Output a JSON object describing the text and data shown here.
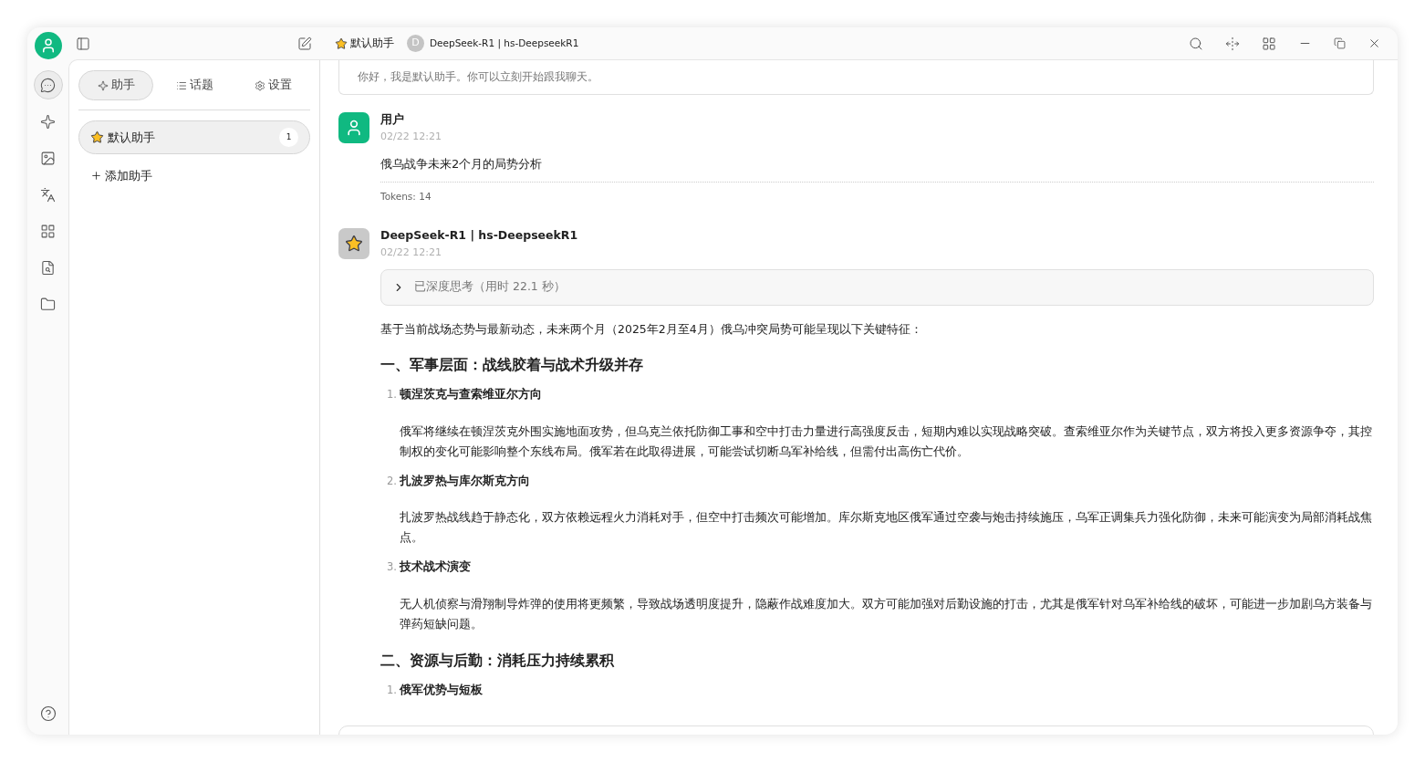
{
  "top_bar": {
    "assistant": "默认助手",
    "model_initial": "D",
    "model": "DeepSeek-R1 | hs-DeepseekR1"
  },
  "rail": [
    {
      "kind": "chat",
      "selected": true
    },
    {
      "kind": "agents",
      "selected": false
    },
    {
      "kind": "image",
      "selected": false
    },
    {
      "kind": "translate",
      "selected": false
    },
    {
      "kind": "apps",
      "selected": false
    },
    {
      "kind": "knowledge",
      "selected": false
    },
    {
      "kind": "files",
      "selected": false
    }
  ],
  "sidebar": {
    "tabs": [
      {
        "kind": "assistants",
        "label": "助手",
        "selected": true
      },
      {
        "kind": "topics",
        "label": "话题",
        "selected": false
      },
      {
        "kind": "settings",
        "label": "设置",
        "selected": false
      }
    ],
    "assistants": [
      {
        "name": "默认助手",
        "count": "1",
        "selected": true
      }
    ],
    "add_label": "添加助手"
  },
  "greeting": "你好，我是默认助手。你可以立刻开始跟我聊天。",
  "messages": [
    {
      "kind": "user",
      "name": "用户",
      "time": "02/22 12:21",
      "text": "俄乌战争未来2个月的局势分析",
      "tokens": "Tokens: 14"
    },
    {
      "kind": "assistant",
      "name": "DeepSeek-R1 | hs-DeepseekR1",
      "time": "02/22 12:21",
      "thinking": {
        "label": "已深度思考（用时 22.1 秒）",
        "expanded": false
      },
      "intro": "基于当前战场态势与最新动态，未来两个月（2025年2月至4月）俄乌冲突局势可能呈现以下关键特征：",
      "sections": [
        {
          "heading": "一、军事层面：战线胶着与战术升级并存",
          "items": [
            {
              "number": "1.",
              "title": "顿涅茨克与查索维亚尔方向",
              "body": "俄军将继续在顿涅茨克外围实施地面攻势，但乌克兰依托防御工事和空中打击力量进行高强度反击，短期内难以实现战略突破。查索维亚尔作为关键节点，双方将投入更多资源争夺，其控制权的变化可能影响整个东线布局。俄军若在此取得进展，可能尝试切断乌军补给线，但需付出高伤亡代价。"
            },
            {
              "number": "2.",
              "title": "扎波罗热与库尔斯克方向",
              "body": "扎波罗热战线趋于静态化，双方依赖远程火力消耗对手，但空中打击频次可能增加。库尔斯克地区俄军通过空袭与炮击持续施压，乌军正调集兵力强化防御，未来可能演变为局部消耗战焦点。"
            },
            {
              "number": "3.",
              "title": "技术战术演变",
              "body": "无人机侦察与滑翔制导炸弹的使用将更频繁，导致战场透明度提升，隐蔽作战难度加大。双方可能加强对后勤设施的打击，尤其是俄军针对乌军补给线的破坏，可能进一步加剧乌方装备与弹药短缺问题。"
            }
          ]
        },
        {
          "heading": "二、资源与后勤：消耗压力持续累积",
          "items": [
            {
              "number": "1.",
              "title": "俄军优势与短板"
            }
          ]
        }
      ]
    }
  ]
}
